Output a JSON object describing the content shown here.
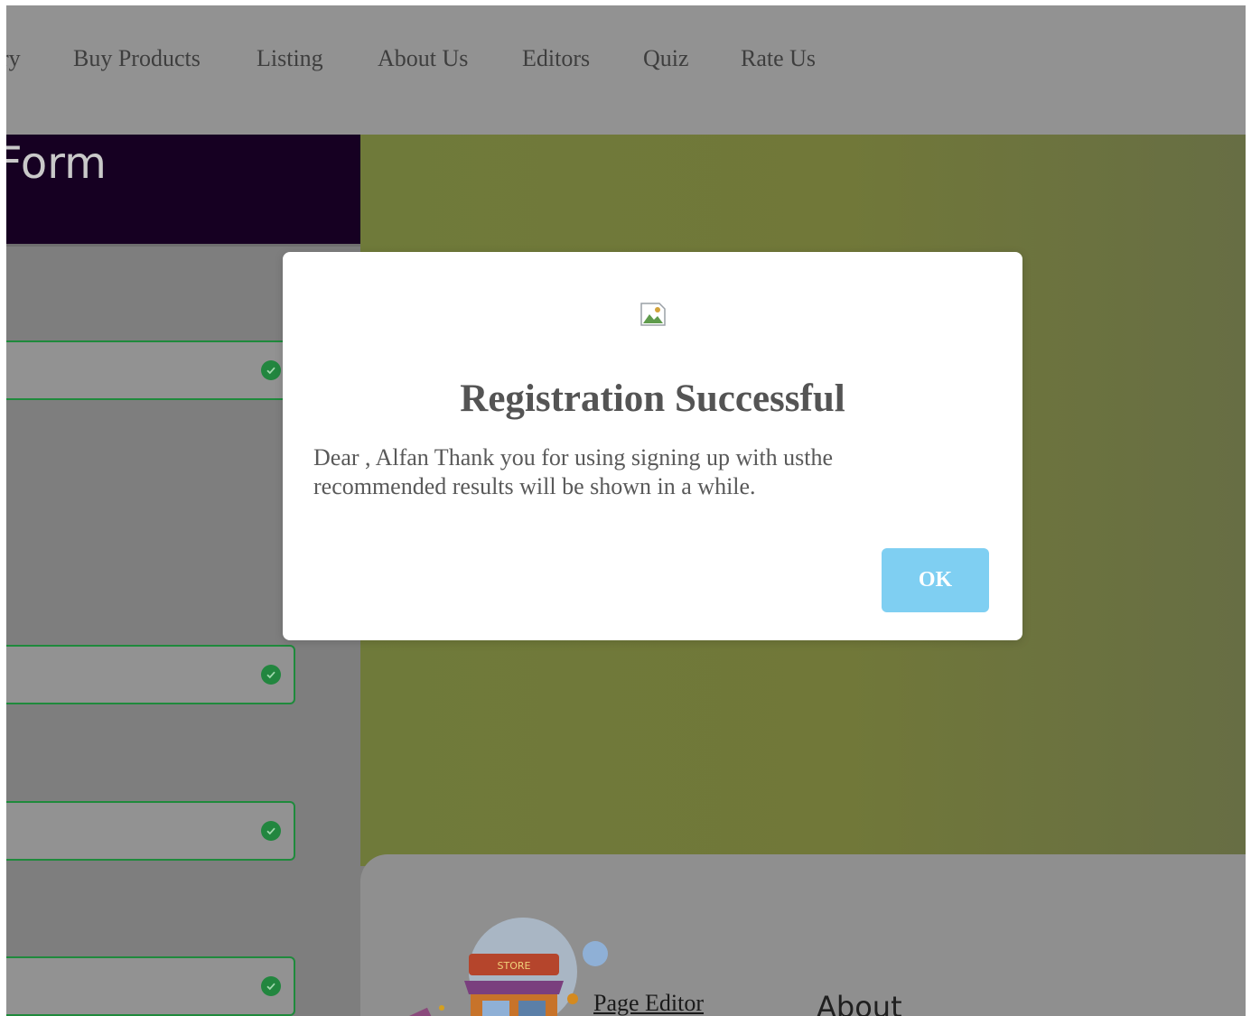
{
  "nav": {
    "items": [
      {
        "label": "ry"
      },
      {
        "label": "Buy Products"
      },
      {
        "label": "Listing"
      },
      {
        "label": "About Us"
      },
      {
        "label": "Editors"
      },
      {
        "label": "Quiz"
      },
      {
        "label": "Rate Us"
      }
    ]
  },
  "form": {
    "title": "Form",
    "fields": [
      {
        "status_icon": "check-circle-icon"
      },
      {
        "status_icon": "check-circle-icon"
      },
      {
        "status_icon": "check-circle-icon"
      },
      {
        "status_icon": "check-circle-icon"
      }
    ]
  },
  "footer": {
    "illustration_label": "STORE",
    "link_page_editor": "Page Editor",
    "heading_about": "About"
  },
  "modal": {
    "icon": "broken-image-icon",
    "title": "Registration Successful",
    "message": "Dear , Alfan Thank you for using signing up with usthe recommended results will be shown in a while.",
    "ok_label": "OK"
  },
  "colors": {
    "overlay_nav": "#929292",
    "form_header": "#160022",
    "banner": "#717839",
    "field_border": "#1f8a3c",
    "ok_button": "#7fcff2"
  }
}
